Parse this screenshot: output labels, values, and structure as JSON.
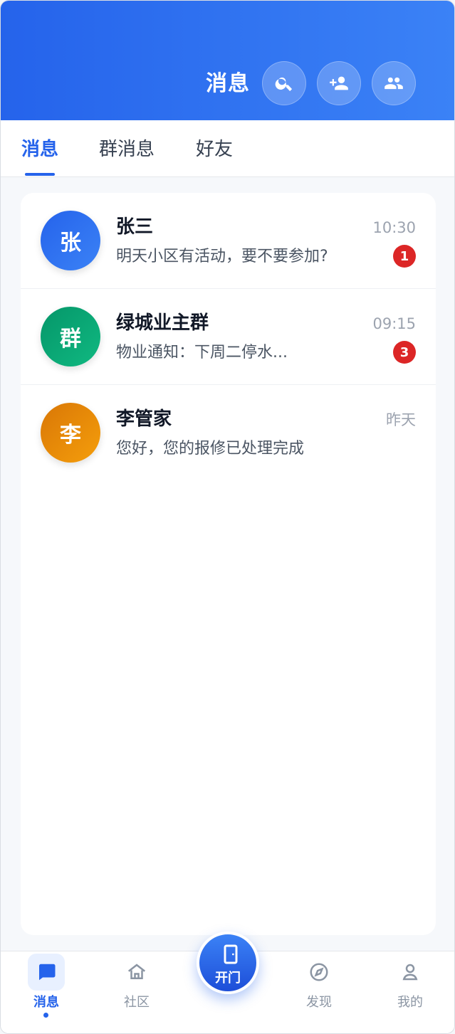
{
  "header": {
    "title": "消息",
    "actions": [
      {
        "name": "search-icon"
      },
      {
        "name": "add-friend-icon"
      },
      {
        "name": "group-icon"
      }
    ]
  },
  "tabs": [
    {
      "label": "消息",
      "active": true
    },
    {
      "label": "群消息",
      "active": false
    },
    {
      "label": "好友",
      "active": false
    }
  ],
  "conversations": [
    {
      "avatar_text": "张",
      "name": "张三",
      "preview": "明天小区有活动，要不要参加?",
      "time": "10:30",
      "unread": "1",
      "avatar_colors": [
        "#2563eb",
        "#3b82f6"
      ]
    },
    {
      "avatar_text": "群",
      "name": "绿城业主群",
      "preview": "物业通知：下周二停水...",
      "time": "09:15",
      "unread": "3",
      "avatar_colors": [
        "#059669",
        "#10b981"
      ]
    },
    {
      "avatar_text": "李",
      "name": "李管家",
      "preview": "您好，您的报修已处理完成",
      "time": "昨天",
      "unread": "",
      "avatar_colors": [
        "#d97706",
        "#f59e0b"
      ]
    }
  ],
  "bottom_nav": {
    "items": [
      {
        "label": "消息",
        "icon": "chat-icon",
        "active": true
      },
      {
        "label": "社区",
        "icon": "home-icon",
        "active": false
      },
      {
        "label": "发现",
        "icon": "compass-icon",
        "active": false
      },
      {
        "label": "我的",
        "icon": "user-icon",
        "active": false
      }
    ],
    "center_action": {
      "label": "开门",
      "icon": "door-icon"
    }
  },
  "colors": {
    "brand": "#2563eb",
    "badge": "#dc2626",
    "muted": "#8b95a3"
  }
}
